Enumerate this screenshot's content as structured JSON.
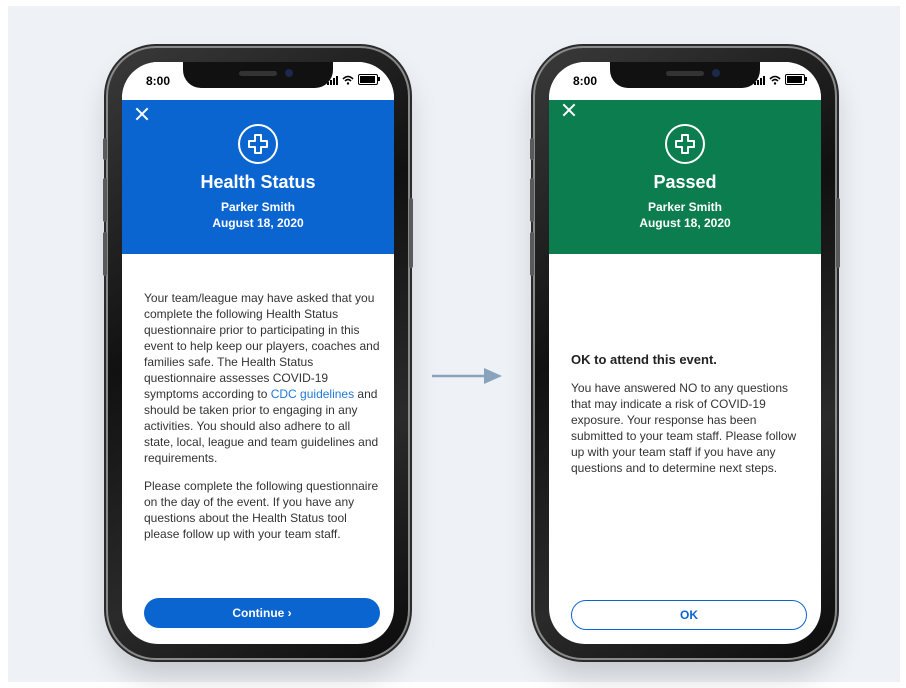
{
  "colors": {
    "health_blue": "#0b65d1",
    "passed_green": "#0c7d4e",
    "link_blue": "#1f79d9",
    "arrow": "#8aa3bd"
  },
  "left_phone": {
    "time": "8:00",
    "header": {
      "title": "Health Status",
      "name": "Parker Smith",
      "date": "August 18, 2020",
      "icon": "medical-cross-icon"
    },
    "paragraph1_before_link": "Your team/league may have asked that you complete the following Health Status questionnaire prior to participating in this event to help keep our players, coaches and families safe. The Health Status questionnaire assesses COVID-19 symptoms according to ",
    "paragraph1_link": "CDC guidelines",
    "paragraph1_after_link": " and should be taken prior to engaging in any activities. You should also adhere to all state, local, league and team guidelines and requirements.",
    "paragraph2": "Please complete the following questionnaire on the day of the event. If you have any questions about the Health Status tool please follow up with your team staff.",
    "button_label": "Continue ›"
  },
  "right_phone": {
    "time": "8:00",
    "header": {
      "title": "Passed",
      "name": "Parker Smith",
      "date": "August 18, 2020",
      "icon": "medical-cross-icon"
    },
    "heading": "OK to attend this event.",
    "paragraph": "You have answered NO to any questions that may indicate a risk of COVID-19 exposure. Your response has been submitted to your team staff. Please follow up with your team staff if you have any questions and to determine next steps.",
    "button_label": "OK"
  }
}
